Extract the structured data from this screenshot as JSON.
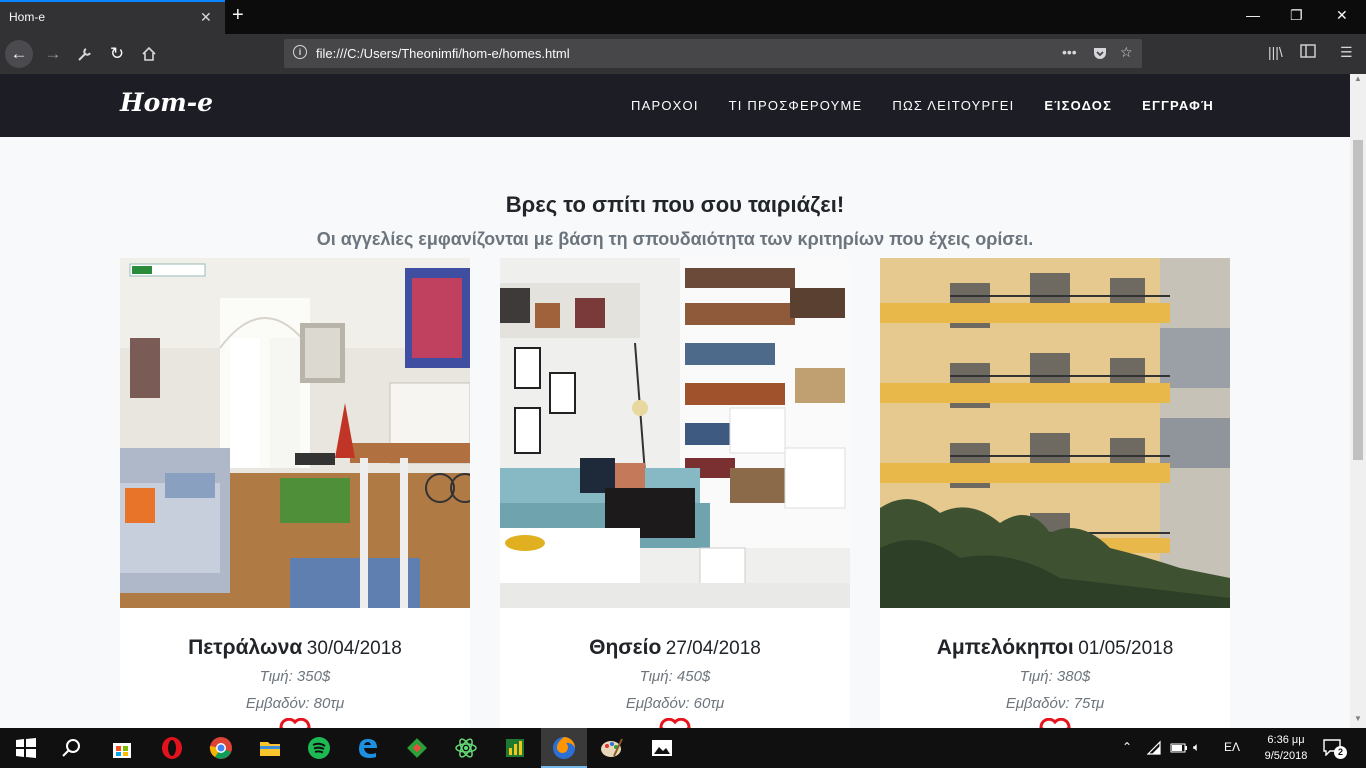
{
  "browser": {
    "tab_title": "Hom-e",
    "url": "file:///C:/Users/Theonimfi/hom-e/homes.html"
  },
  "site": {
    "brand": "Hom-e",
    "menu": [
      "ΠΑΡΟΧΟΙ",
      "ΤΙ ΠΡΟΣΦΕΡΟΥΜΕ",
      "ΠΩΣ ΛΕΙΤΟΥΡΓΕΙ",
      "ΕΊΣΟΔΟΣ",
      "ΕΓΓΡΑΦΉ"
    ],
    "heading": "Βρες το σπίτι που σου ταιριάζει!",
    "subheading": "Οι αγγελίες εμφανίζονται με βάση τη σπουδαιότητα των κριτηρίων που έχεις ορίσει.",
    "listings": [
      {
        "area": "Πετράλωνα",
        "date": "30/04/2018",
        "price": "Τιμή: 350$",
        "size": "Εμβαδόν: 80τμ"
      },
      {
        "area": "Θησείο",
        "date": "27/04/2018",
        "price": "Τιμή: 450$",
        "size": "Εμβαδόν: 60τμ"
      },
      {
        "area": "Αμπελόκηποι",
        "date": "01/05/2018",
        "price": "Τιμή: 380$",
        "size": "Εμβαδόν: 75τμ"
      }
    ]
  },
  "taskbar": {
    "language": "ΕΛ",
    "time": "6:36 μμ",
    "date": "9/5/2018",
    "notifications": "2"
  },
  "colors": {
    "header_bg": "#1d1d26",
    "page_bg": "#f8f9fa",
    "heart": "#e8141d",
    "accent": "#0a84ff"
  }
}
